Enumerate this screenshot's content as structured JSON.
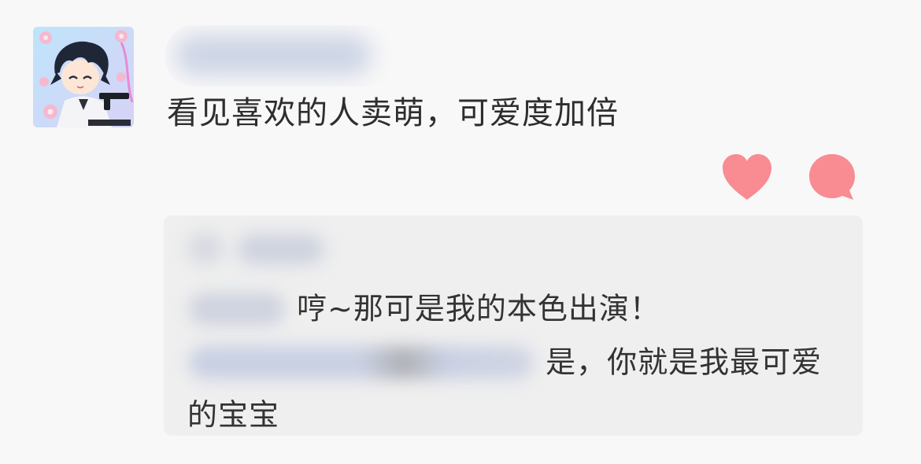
{
  "comment": {
    "text": "看见喜欢的人卖萌，可爱度加倍"
  },
  "actions": {
    "like_icon": "heart-icon",
    "reply_icon": "comment-bubble-icon",
    "accent_color": "#f98b93"
  },
  "replies": {
    "items": [
      {
        "text": "哼~那可是我的本色出演！"
      },
      {
        "text": "是，你就是我最可爱的宝宝"
      }
    ]
  }
}
